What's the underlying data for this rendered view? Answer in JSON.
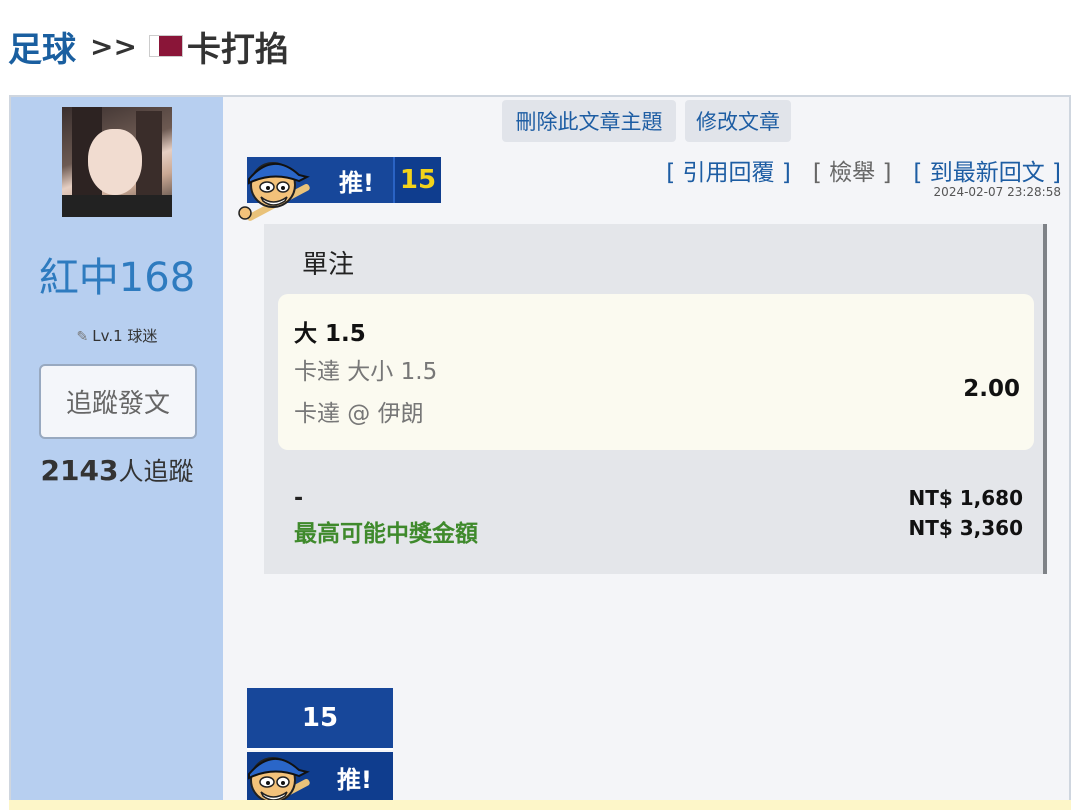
{
  "breadcrumb": {
    "section": "足球",
    "separator": ">>",
    "title": "卡打掐"
  },
  "author": {
    "name": "紅中168",
    "level": "Lv.1 球迷",
    "follow_button": "追蹤發文",
    "followers_count": "2143",
    "followers_suffix": "人追蹤"
  },
  "post": {
    "delete_button": "刪除此文章主題",
    "edit_button": "修改文章",
    "push_label": "推!",
    "push_count": "15",
    "links": {
      "quote_reply": "[ 引用回覆 ]",
      "report": "[ 檢舉 ]",
      "latest_reply": "[ 到最新回文 ]"
    },
    "timestamp": "2024-02-07 23:28:58"
  },
  "bet_slip": {
    "heading": "單注",
    "selection": "大 1.5",
    "market": "卡達 大小 1.5",
    "event": "卡達 @ 伊朗",
    "odds": "2.00",
    "stake_label": "-",
    "stake": "NT$ 1,680",
    "max_payout_label": "最高可能中獎金額",
    "max_payout": "NT$ 3,360"
  },
  "bottom_push": {
    "count": "15",
    "label": "推!"
  },
  "colors": {
    "accent_blue": "#1d5da3",
    "sidebar": "#b7cff0",
    "payout_green": "#3f8a2c",
    "push_count_yellow": "#f3d31a",
    "qatar_maroon": "#8a1538"
  }
}
